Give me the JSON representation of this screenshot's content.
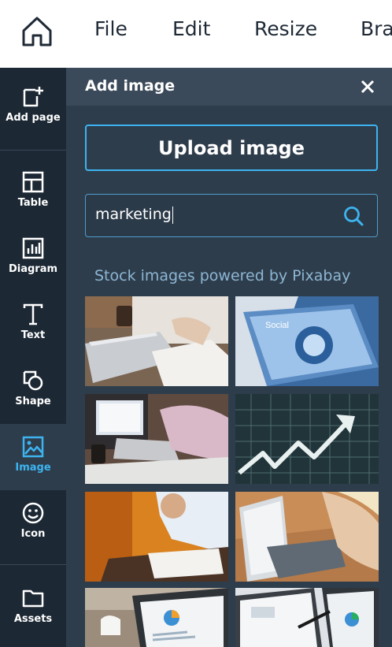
{
  "menu": {
    "file": "File",
    "edit": "Edit",
    "resize": "Resize",
    "brand": "Bra"
  },
  "toolbar": {
    "items": [
      {
        "label": "Add page",
        "icon": "add-page-icon"
      },
      {
        "label": "Table",
        "icon": "table-icon"
      },
      {
        "label": "Diagram",
        "icon": "diagram-icon"
      },
      {
        "label": "Text",
        "icon": "text-icon"
      },
      {
        "label": "Shape",
        "icon": "shape-icon"
      },
      {
        "label": "Image",
        "icon": "image-icon",
        "active": true
      },
      {
        "label": "Icon",
        "icon": "smiley-icon"
      },
      {
        "label": "Assets",
        "icon": "folder-icon"
      }
    ]
  },
  "panel": {
    "title": "Add image",
    "upload_label": "Upload image",
    "search_value": "marketing",
    "stock_label": "Stock images powered by Pixabay"
  },
  "colors": {
    "accent": "#3db4f0",
    "toolbar_bg": "#1c2834",
    "panel_bg": "#2e3d4c",
    "panel_header_bg": "#3b4a5a"
  }
}
